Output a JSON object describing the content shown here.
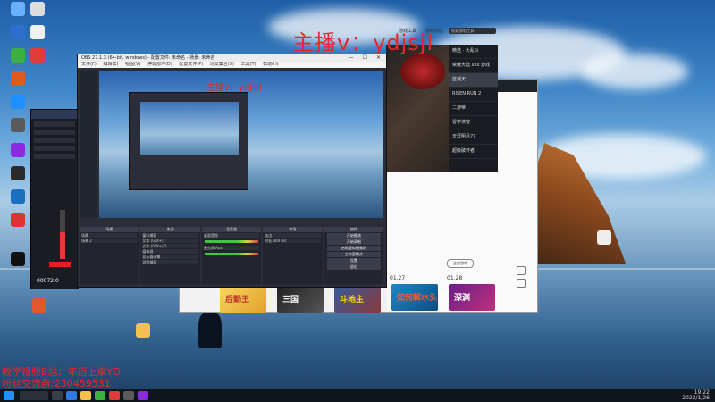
{
  "overlay": {
    "streamer_tag": "主播v：ydjsjl",
    "bottom_line1": "教学视频B站：年迈上单YD",
    "bottom_line2": "粉丝交流群:230459531"
  },
  "desktop": {
    "icon_count": 11
  },
  "obs": {
    "title": "OBS 27.1.3 (64-bit, windows) - 配置文件: 未命名 - 场景: 未命名",
    "menu": [
      "文件(F)",
      "编辑(E)",
      "视图(V)",
      "停靠部件(D)",
      "配置文件(P)",
      "场景集合(S)",
      "工具(T)",
      "帮助(H)"
    ],
    "preview_tag": "主播v：ydjsjl",
    "docks": {
      "scenes": {
        "header": "场景",
        "rows": [
          "场景",
          "场景 2"
        ]
      },
      "sources": {
        "header": "来源",
        "rows": [
          "窗口捕获",
          "文本 (GDI+)",
          "文本 (GDI+) 2",
          "媒体源",
          "显示器采集",
          "游戏捕获"
        ]
      },
      "mixer": {
        "header": "混音器",
        "rows": [
          "桌面音频",
          "麦克风/Aux"
        ]
      },
      "transitions": {
        "header": "转场",
        "rows": [
          "淡出",
          "时长 300 ms"
        ]
      },
      "controls": {
        "header": "控件",
        "buttons": [
          "开始推流",
          "开始录制",
          "启动虚拟摄像机",
          "工作室模式",
          "设置",
          "退出"
        ]
      }
    }
  },
  "mini_app": {
    "time": "00072.0"
  },
  "store": {
    "tabs": [
      "游戏工具",
      "游戏商店"
    ],
    "search_placeholder": "搜索游戏/工具",
    "featured_list": [
      "精选 · 大乱斗",
      "荣耀大陆 xxx 游戏",
      "蓝凝天",
      "RISEN RUN 2",
      "二游帝",
      "冒学侠客",
      "天涯明月刀",
      "超级破坏者"
    ],
    "all_button": "全部游戏",
    "dates": [
      "01.27",
      "01.28"
    ],
    "thumbs": [
      "后勤王",
      "三国",
      "斗地主",
      "如何解水头",
      "深渊"
    ]
  },
  "taskbar": {
    "time": "19:22",
    "date": "2022/1/26"
  }
}
